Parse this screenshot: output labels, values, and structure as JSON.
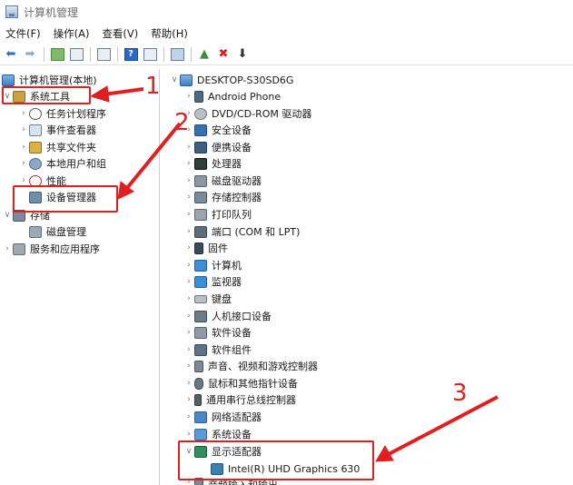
{
  "window": {
    "title": "计算机管理"
  },
  "menu": [
    "文件(F)",
    "操作(A)",
    "查看(V)",
    "帮助(H)"
  ],
  "left_tree": {
    "root": "计算机管理(本地)",
    "system_tools": "系统工具",
    "task_scheduler": "任务计划程序",
    "event_viewer": "事件查看器",
    "shared_folders": "共享文件夹",
    "local_users": "本地用户和组",
    "performance": "性能",
    "device_manager": "设备管理器",
    "storage": "存储",
    "disk_management": "磁盘管理",
    "services_apps": "服务和应用程序"
  },
  "right_tree": {
    "root": "DESKTOP-S30SD6G",
    "categories": [
      "Android Phone",
      "DVD/CD-ROM 驱动器",
      "安全设备",
      "便携设备",
      "处理器",
      "磁盘驱动器",
      "存储控制器",
      "打印队列",
      "端口 (COM 和 LPT)",
      "固件",
      "计算机",
      "监视器",
      "键盘",
      "人机接口设备",
      "软件设备",
      "软件组件",
      "声音、视频和游戏控制器",
      "鼠标和其他指针设备",
      "通用串行总线控制器",
      "网络适配器",
      "系统设备",
      "显示适配器"
    ],
    "display_child": "Intel(R) UHD Graphics 630",
    "partial_next": "音频输入和输出"
  },
  "annotations": {
    "step1": "1",
    "step2": "2",
    "step3": "3"
  },
  "colors": {
    "annotation_red": "#e02020"
  }
}
